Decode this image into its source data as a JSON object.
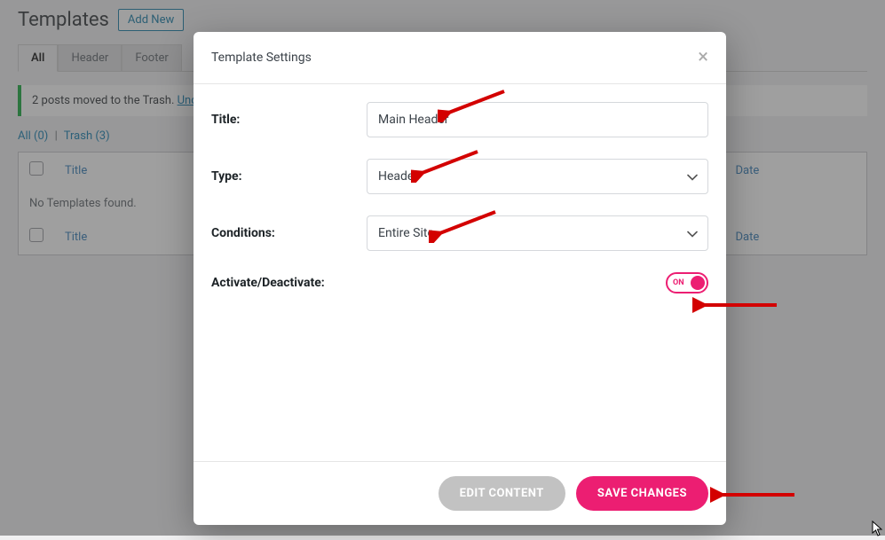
{
  "page": {
    "title": "Templates",
    "add_new": "Add New"
  },
  "tabs": [
    {
      "label": "All",
      "active": true
    },
    {
      "label": "Header",
      "active": false
    },
    {
      "label": "Footer",
      "active": false
    }
  ],
  "notice": {
    "text": "2 posts moved to the Trash. ",
    "link": "Undo"
  },
  "subsub": {
    "all_label": "All",
    "all_count": "(0)",
    "trash_label": "Trash",
    "trash_count": "(3)"
  },
  "table": {
    "col_title": "Title",
    "col_date": "Date",
    "no_items": "No Templates found."
  },
  "modal": {
    "title": "Template Settings",
    "fields": {
      "title_label": "Title:",
      "title_value": "Main Header",
      "type_label": "Type:",
      "type_value": "Header",
      "conditions_label": "Conditions:",
      "conditions_value": "Entire Site",
      "activate_label": "Activate/Deactivate:",
      "toggle_state": "ON"
    },
    "footer": {
      "edit_content": "EDIT CONTENT",
      "save_changes": "SAVE CHANGES"
    }
  },
  "colors": {
    "accent": "#ec1e72",
    "link": "#0073aa"
  }
}
